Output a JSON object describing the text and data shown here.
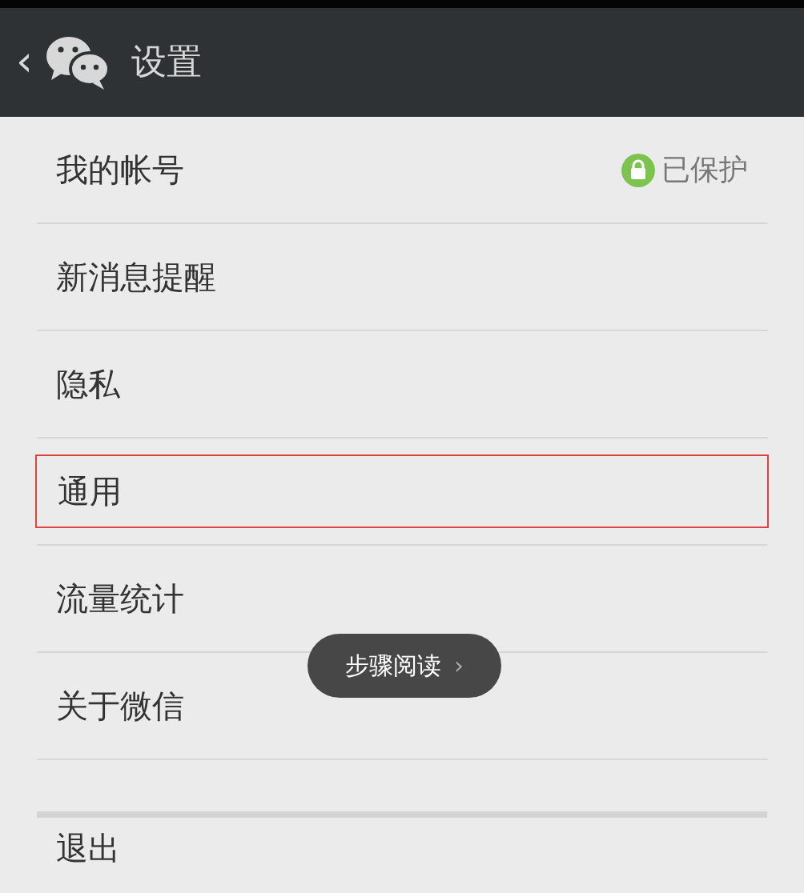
{
  "header": {
    "back": "‹",
    "title": "设置"
  },
  "items": [
    {
      "label": "我的帐号",
      "status": "已保护",
      "highlighted": false
    },
    {
      "label": "新消息提醒",
      "highlighted": false
    },
    {
      "label": "隐私",
      "highlighted": false
    },
    {
      "label": "通用",
      "highlighted": true
    },
    {
      "label": "流量统计",
      "highlighted": false
    },
    {
      "label": "关于微信",
      "highlighted": false
    }
  ],
  "logout": "退出",
  "overlay_button": {
    "label": "步骤阅读",
    "chevron": "›"
  }
}
